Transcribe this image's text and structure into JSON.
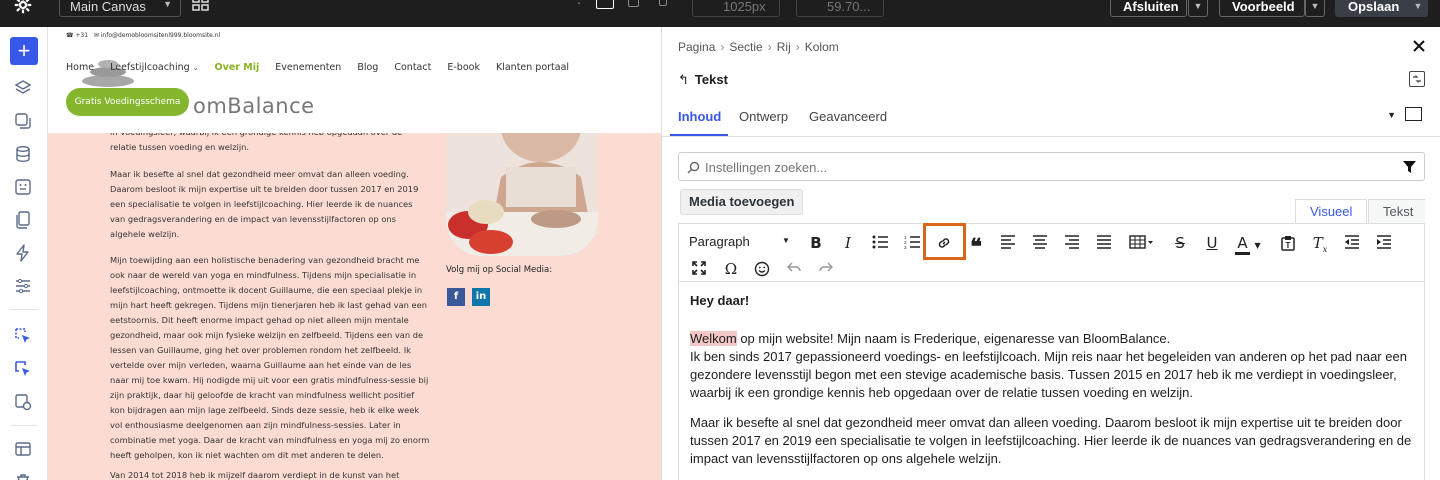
{
  "topbar": {
    "canvas_label": "Main Canvas",
    "width_value": "1025px",
    "zoom_value": "59.70...",
    "close_label": "Afsluiten",
    "preview_label": "Voorbeeld",
    "save_label": "Opslaan"
  },
  "preview": {
    "phone": "+31",
    "email": "info@demobloomsitenl999.bloomsite.nl",
    "nav": [
      "Home",
      "Leefstijlcoaching",
      "Over Mij",
      "Evenementen",
      "Blog",
      "Contact",
      "E-book",
      "Klanten portaal"
    ],
    "logo_text": "omBalance",
    "cta_label": "Gratis Voedingsschema",
    "paragraphs": [
      "in voedingsleer, waarbij ik een grondige kennis heb opgedaan over de relatie tussen voeding en welzijn.",
      "Maar ik besefte al snel dat gezondheid meer omvat dan alleen voeding. Daarom besloot ik mijn expertise uit te breiden door tussen 2017 en 2019 een specialisatie te volgen in leefstijlcoaching. Hier leerde ik de nuances van gedragsverandering en de impact van levensstijlfactoren op ons algehele welzijn.",
      "Mijn toewijding aan een holistische benadering van gezondheid bracht me ook naar de wereld van yoga en mindfulness. Tijdens mijn specialisatie in leefstijlcoaching, ontmoette ik docent Guillaume, die een speciaal plekje in mijn hart heeft gekregen. Tijdens mijn tienerjaren heb ik last gehad van een eetstoornis. Dit heeft enorme impact gehad op niet alleen mijn mentale gezondheid, maar ook mijn fysieke welzijn en zelfbeeld. Tijdens een van de lessen van Guillaume, ging het over problemen rondom het zelfbeeld. Ik vertelde over mijn verleden, waarna Guillaume aan het einde van de les naar mij toe kwam. Hij nodigde mij uit voor een gratis mindfulness-sessie bij zijn praktijk, daar hij geloofde de kracht van mindfulness wellicht positief kon bijdragen aan mijn lage zelfbeeld. Sinds deze sessie, heb ik elke week vol enthousiasme deelgenomen aan zijn mindfulness-sessies. Later in combinatie met yoga. Daar de kracht van mindfulness en yoga mij zo enorm heeft geholpen, kon ik niet wachten om dit met anderen te delen.",
      "Van 2014 tot 2018 heb ik mijzelf daarom verdiept in de kunst van het"
    ],
    "social_label": "Volg mij op Social Media:",
    "social": [
      "f",
      "in"
    ]
  },
  "panel": {
    "breadcrumbs": [
      "Pagina",
      "Sectie",
      "Rij",
      "Kolom"
    ],
    "element_title": "Tekst",
    "tabs": [
      "Inhoud",
      "Ontwerp",
      "Geavanceerd"
    ],
    "search_placeholder": "Instellingen zoeken...",
    "media_button": "Media toevoegen",
    "view_tabs": [
      "Visueel",
      "Tekst"
    ],
    "format_select": "Paragraph",
    "content": {
      "heading": "Hey daar!",
      "highlight_word": "Welkom",
      "p1_rest": " op mijn website! Mijn naam is Frederique, eigenaresse van BloomBalance.",
      "p1_line2": "Ik ben sinds 2017 gepassioneerd voedings- en leefstijlcoach. Mijn reis naar het begeleiden van anderen op het pad naar een gezondere levensstijl begon met een stevige academische basis. Tussen 2015 en 2017 heb ik me verdiept in voedingsleer, waarbij ik een grondige kennis heb opgedaan over de relatie tussen voeding en welzijn.",
      "p2": "Maar ik besefte al snel dat gezondheid meer omvat dan alleen voeding. Daarom besloot ik mijn expertise uit te breiden door tussen 2017 en 2019 een specialisatie te volgen in leefstijlcoaching. Hier leerde ik de nuances van gedragsverandering en de impact van levensstijlfactoren op ons algehele welzijn."
    }
  },
  "colors": {
    "accent": "#3858e9",
    "preview_bg": "#fcdcd2",
    "cta_green": "#84b72e",
    "highlight_box": "#d9661a"
  }
}
